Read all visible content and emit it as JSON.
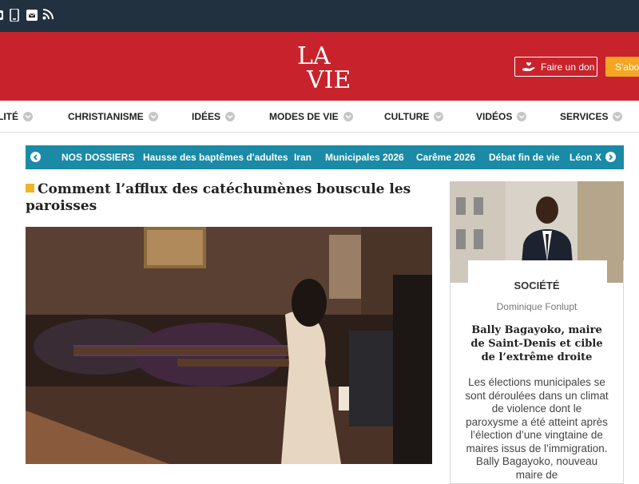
{
  "topbar": {
    "icons": [
      "instagram-icon",
      "mobile-icon",
      "newsletter-icon",
      "rss-icon"
    ],
    "background": "#22313f"
  },
  "brand": {
    "logo_line1": "LA",
    "logo_line2": "VIE",
    "donate_label": "Faire un don",
    "subscribe_label": "S'abo",
    "background": "#c8232c",
    "subscribe_color": "#f5a623"
  },
  "nav": {
    "items": [
      "LITÉ",
      "CHRISTIANISME",
      "IDÉES",
      "MODES DE VIE",
      "CULTURE",
      "VIDÉOS",
      "SERVICES"
    ]
  },
  "dossiers": {
    "title": "NOS DOSSIERS",
    "links": [
      "Hausse des baptêmes d'adultes",
      "Iran",
      "Municipales 2026",
      "Carême 2026",
      "Débat fin de vie",
      "Léon X"
    ],
    "background": "#1a8aa6"
  },
  "article": {
    "headline": "Comment l’afflux des catéchumènes bouscule les paroisses"
  },
  "card": {
    "rubric": "SOCIÉTÉ",
    "author": "Dominique Fonlupt",
    "title": "Bally Bagayoko, maire de Saint-Denis et cible de l’extrême droite",
    "text": "Les élections municipales se sont déroulées dans un climat de violence dont le paroxysme a été atteint après l’élection d’une vingtaine de maires issus de l’immigration. Bally Bagayoko, nouveau maire de"
  }
}
